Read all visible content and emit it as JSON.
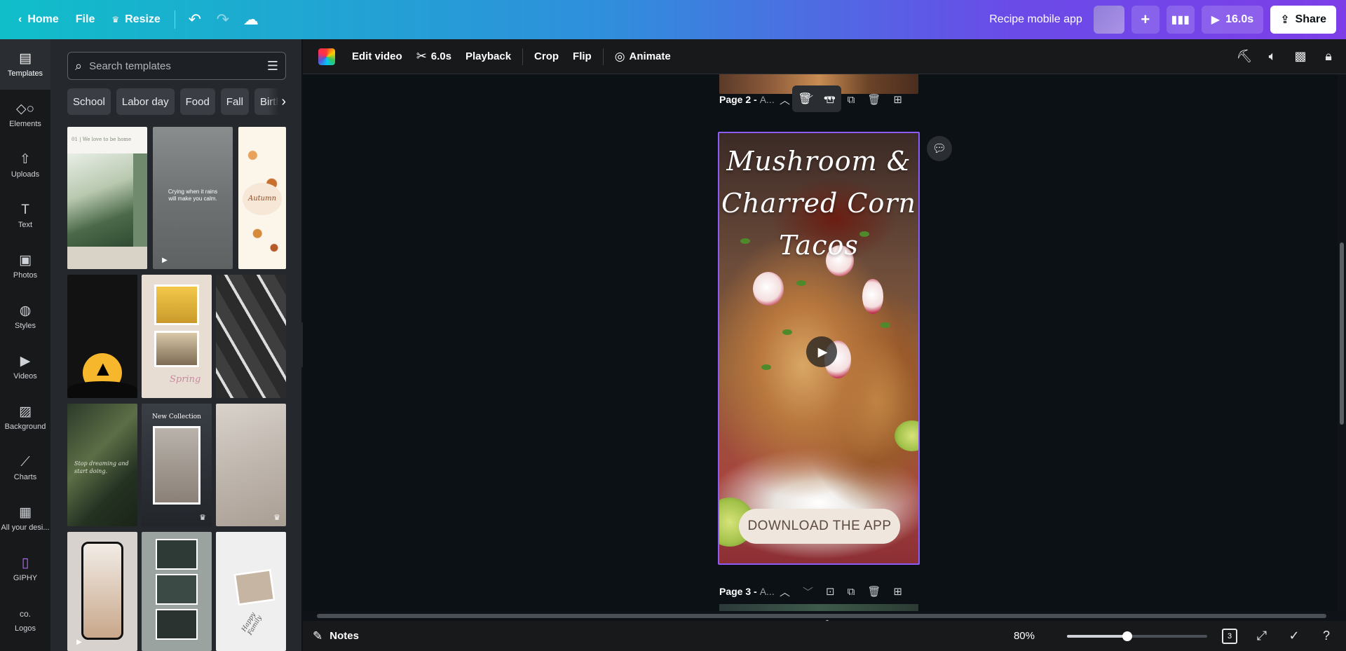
{
  "topbar": {
    "home_label": "Home",
    "file_label": "File",
    "resize_label": "Resize",
    "design_title": "Recipe mobile app",
    "play_duration": "16.0s",
    "share_label": "Share"
  },
  "rail": {
    "items": [
      {
        "label": "Templates",
        "icon": "templates-icon"
      },
      {
        "label": "Elements",
        "icon": "elements-icon"
      },
      {
        "label": "Uploads",
        "icon": "uploads-icon"
      },
      {
        "label": "Text",
        "icon": "text-icon"
      },
      {
        "label": "Photos",
        "icon": "photos-icon"
      },
      {
        "label": "Styles",
        "icon": "styles-icon"
      },
      {
        "label": "Videos",
        "icon": "videos-icon"
      },
      {
        "label": "Background",
        "icon": "background-icon"
      },
      {
        "label": "Charts",
        "icon": "charts-icon"
      },
      {
        "label": "All your desi...",
        "icon": "all-designs-icon"
      },
      {
        "label": "GIPHY",
        "icon": "giphy-icon"
      },
      {
        "label": "Logos",
        "icon": "logos-icon"
      }
    ]
  },
  "panel": {
    "search_placeholder": "Search templates",
    "chips": [
      "School",
      "Labor day",
      "Food",
      "Fall",
      "Birth"
    ],
    "thumbs": [
      {
        "text": "01 | We love to be home"
      },
      {
        "text": "Crying when it rains will make you calm."
      },
      {
        "text": "Autumn"
      },
      {
        "text": ""
      },
      {
        "text": "Spring"
      },
      {
        "text": ""
      },
      {
        "text": "Stop dreaming and start doing."
      },
      {
        "text": "New Collection"
      },
      {
        "text": ""
      },
      {
        "text": ""
      },
      {
        "text": ""
      },
      {
        "text": "Happy Family"
      }
    ]
  },
  "context_toolbar": {
    "edit_video_label": "Edit video",
    "duration_label": "6.0s",
    "playback_label": "Playback",
    "crop_label": "Crop",
    "flip_label": "Flip",
    "animate_label": "Animate"
  },
  "canvas": {
    "page2_label": "Page 2 - ",
    "page2_suffix": "A...",
    "page3_label": "Page 3 - ",
    "page3_suffix": "A...",
    "design_title_line1": "Mushroom &",
    "design_title_line2": "Charred Corn",
    "design_title_line3": "Tacos",
    "cta_label": "DOWNLOAD THE APP"
  },
  "bottombar": {
    "notes_label": "Notes",
    "zoom_label": "80%",
    "zoom_level_fraction": 0.43,
    "page_count": "3"
  },
  "colors": {
    "selection": "#8b5cf6",
    "panel_bg": "#25282c",
    "canvas_bg": "#0c1115"
  }
}
